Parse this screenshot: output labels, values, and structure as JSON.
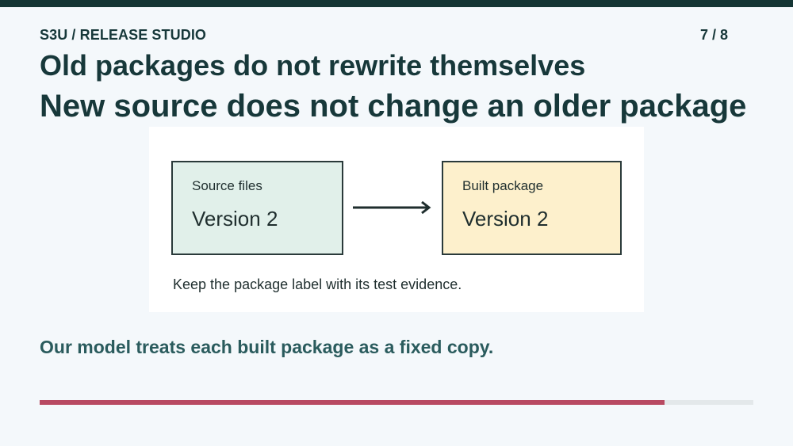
{
  "header": {
    "kicker": "S3U / RELEASE STUDIO",
    "counter": "7 / 8"
  },
  "slide": {
    "title": "Old packages do not rewrite themselves",
    "subtitle": "New source does not change an older package",
    "diagram": {
      "source_box": {
        "label": "Source files",
        "version": "Version 2"
      },
      "package_box": {
        "label": "Built package",
        "version": "Version 2"
      },
      "caption": "Keep the package label with its test evidence."
    },
    "takeaway": "Our model treats each built package as a fixed copy."
  },
  "progress": {
    "fraction": 0.875
  },
  "colors": {
    "top_bar": "#143534",
    "source_box_fill": "#e1f0ea",
    "package_box_fill": "#fdf0cc",
    "progress_fill": "#b84a62",
    "takeaway_text": "#2a5b5d"
  }
}
